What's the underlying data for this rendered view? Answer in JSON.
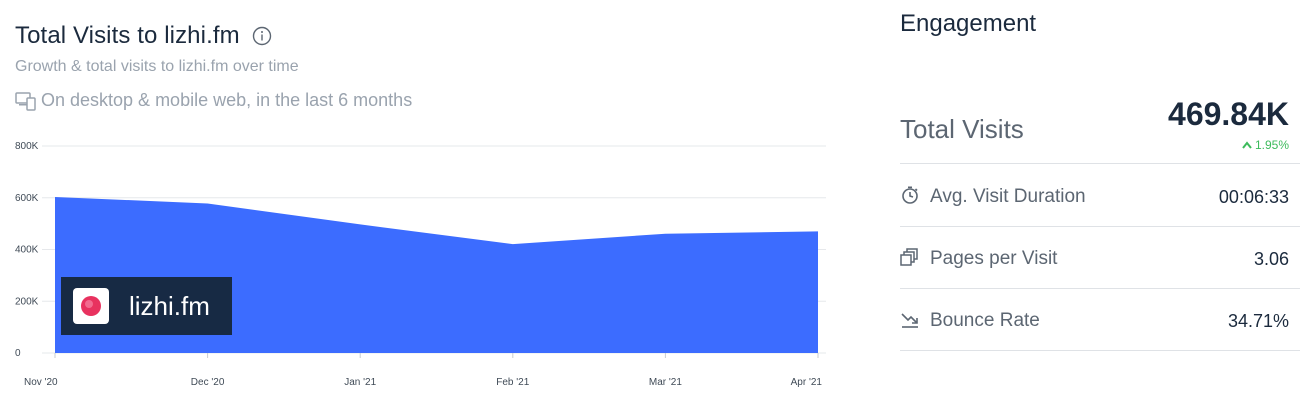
{
  "header": {
    "title": "Total Visits to lizhi.fm",
    "subtitle": "Growth & total visits to lizhi.fm over time",
    "device_text": "On desktop & mobile web, in the last 6 months"
  },
  "badge": {
    "label": "lizhi.fm"
  },
  "chart_data": {
    "type": "area",
    "x": [
      "Nov '20",
      "Dec '20",
      "Jan '21",
      "Feb '21",
      "Mar '21",
      "Apr '21"
    ],
    "y_ticks": [
      "800K",
      "600K",
      "400K",
      "200K",
      "0"
    ],
    "ylim": [
      0,
      800000
    ],
    "series": [
      {
        "values": [
          603000,
          578000,
          497000,
          421000,
          461000,
          469840
        ]
      }
    ],
    "grid": true,
    "colors": {
      "fill": "#3c6cff",
      "grid": "#e6e8eb"
    }
  },
  "engagement": {
    "title": "Engagement",
    "total_visits": {
      "label": "Total Visits",
      "value": "469.84K",
      "change": "1.95%"
    },
    "metrics": [
      {
        "icon": "clock-icon",
        "label": "Avg. Visit Duration",
        "value": "00:06:33"
      },
      {
        "icon": "pages-icon",
        "label": "Pages per Visit",
        "value": "3.06"
      },
      {
        "icon": "bounce-icon",
        "label": "Bounce Rate",
        "value": "34.71%"
      }
    ]
  }
}
